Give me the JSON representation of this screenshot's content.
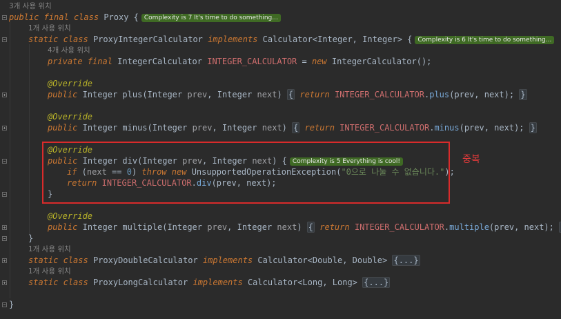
{
  "usages": {
    "proxy": "3개 사용 위치",
    "integer_calc": "1개 사용 위치",
    "integer_field": "4개 사용 위치",
    "double_calc": "1개 사용 위치",
    "long_calc": "1개 사용 위치"
  },
  "complexity": {
    "proxy": "Complexity is 7 It's time to do something...",
    "integer_calc": "Complexity is 6 It's time to do something...",
    "div": "Complexity is 5 Everything is cool!"
  },
  "code": {
    "public": "public",
    "final": "final",
    "class": "class",
    "static": "static",
    "private": "private",
    "implements": "implements",
    "new": "new",
    "return": "return",
    "if": "if",
    "throw": "throw",
    "override": "@Override",
    "proxy_name": "Proxy",
    "integer_calc_name": "ProxyIntegerCalculator",
    "integer_calc_iface": "Calculator<Integer, Integer>",
    "field_type": "IntegerCalculator",
    "field_name": "INTEGER_CALCULATOR",
    "field_init": "IntegerCalculator",
    "integer_type": "Integer",
    "param_prev": "prev",
    "param_next": "next",
    "plus": "plus",
    "minus": "minus",
    "div": "div",
    "multiple": "multiple",
    "zero": "0",
    "exception": "UnsupportedOperationException",
    "error_message": "\"0으로 나눌 수 없습니다.\"",
    "double_calc_name": "ProxyDoubleCalculator",
    "double_calc_iface": "Calculator<Double, Double>",
    "long_calc_name": "ProxyLongCalculator",
    "long_calc_iface": "Calculator<Long, Long>",
    "folded": "{...}"
  },
  "annotation": {
    "label": "중복",
    "color": "#d92b2b"
  }
}
